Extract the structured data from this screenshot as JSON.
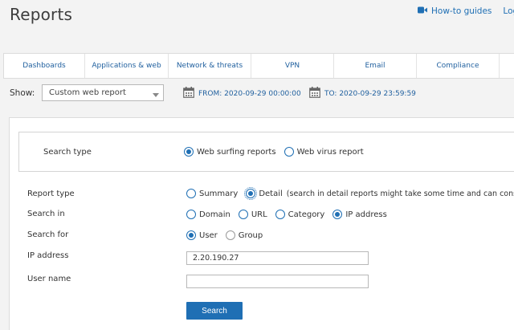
{
  "header": {
    "title": "Reports",
    "howto_label": "How-to guides",
    "logview_label": "Log vi"
  },
  "tabs": [
    "Dashboards",
    "Applications & web",
    "Network & threats",
    "VPN",
    "Email",
    "Compliance"
  ],
  "show": {
    "label": "Show:",
    "selected": "Custom web report"
  },
  "dates": {
    "from": "FROM: 2020-09-29 00:00:00",
    "to": "TO: 2020-09-29 23:59:59"
  },
  "search_type": {
    "label": "Search type",
    "options": [
      {
        "label": "Web surfing reports",
        "selected": true
      },
      {
        "label": "Web virus report",
        "selected": false
      }
    ]
  },
  "form": {
    "report_type": {
      "label": "Report type",
      "summary_label": "Summary",
      "detail_label": "Detail",
      "detail_note": "(search in detail reports might take some time and can consume"
    },
    "search_in": {
      "label": "Search in",
      "options": [
        "Domain",
        "URL",
        "Category",
        "IP address"
      ]
    },
    "search_for": {
      "label": "Search for",
      "options": [
        "User",
        "Group"
      ]
    },
    "ip_address": {
      "label": "IP address",
      "value": "2.20.190.27"
    },
    "user_name": {
      "label": "User name",
      "value": ""
    },
    "search_button": "Search"
  },
  "colors": {
    "accent": "#1f6fb4",
    "tab_text": "#1f5f9e",
    "background": "#f3f3f3"
  }
}
